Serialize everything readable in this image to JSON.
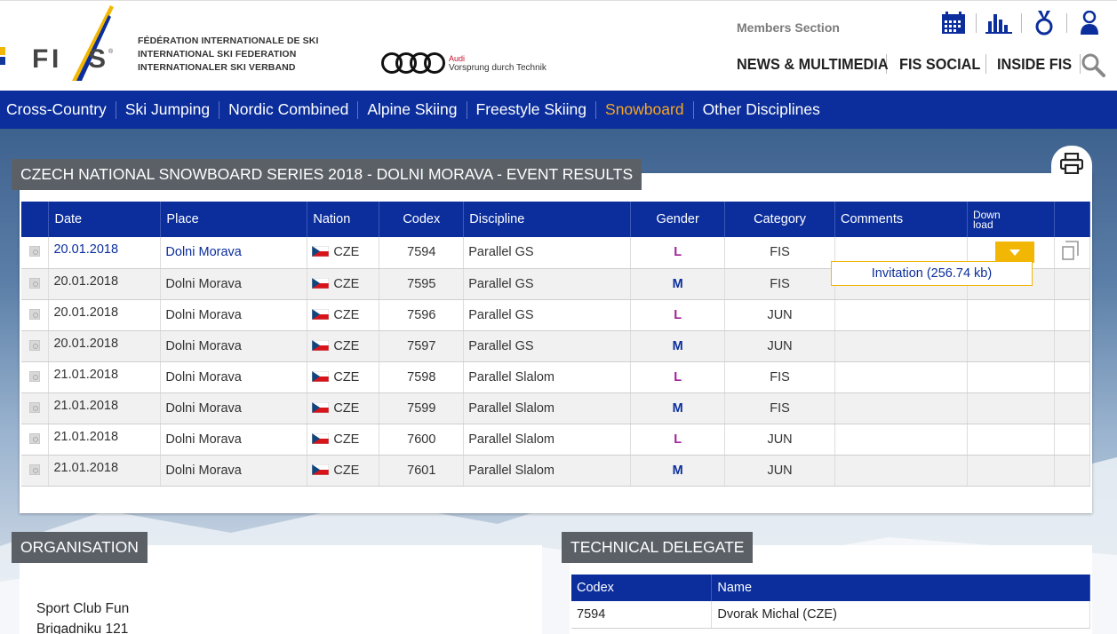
{
  "header": {
    "federation_lines": [
      "FÉDÉRATION INTERNATIONALE DE SKI",
      "INTERNATIONAL SKI FEDERATION",
      "INTERNATIONALER SKI VERBAND"
    ],
    "sponsor": {
      "brand": "Audi",
      "tagline": "Vorsprung durch Technik"
    },
    "members_label": "Members Section",
    "nav": [
      "NEWS & MULTIMEDIA",
      "FIS SOCIAL",
      "INSIDE FIS"
    ]
  },
  "disciplines": [
    "Cross-Country",
    "Ski Jumping",
    "Nordic Combined",
    "Alpine Skiing",
    "Freestyle Skiing",
    "Snowboard",
    "Other Disciplines"
  ],
  "active_discipline": "Snowboard",
  "results": {
    "title": "CZECH NATIONAL SNOWBOARD SERIES 2018 - DOLNI MORAVA - EVENT RESULTS",
    "columns": {
      "date": "Date",
      "place": "Place",
      "nation": "Nation",
      "codex": "Codex",
      "discipline": "Discipline",
      "gender": "Gender",
      "category": "Category",
      "comments": "Comments",
      "download_1": "Down",
      "download_2": "load"
    },
    "rows": [
      {
        "date": "20.01.2018",
        "place": "Dolni Morava",
        "nation": "CZE",
        "codex": "7594",
        "discipline": "Parallel GS",
        "gender": "L",
        "category": "FIS"
      },
      {
        "date": "20.01.2018",
        "place": "Dolni Morava",
        "nation": "CZE",
        "codex": "7595",
        "discipline": "Parallel GS",
        "gender": "M",
        "category": "FIS"
      },
      {
        "date": "20.01.2018",
        "place": "Dolni Morava",
        "nation": "CZE",
        "codex": "7596",
        "discipline": "Parallel GS",
        "gender": "L",
        "category": "JUN"
      },
      {
        "date": "20.01.2018",
        "place": "Dolni Morava",
        "nation": "CZE",
        "codex": "7597",
        "discipline": "Parallel GS",
        "gender": "M",
        "category": "JUN"
      },
      {
        "date": "21.01.2018",
        "place": "Dolni Morava",
        "nation": "CZE",
        "codex": "7598",
        "discipline": "Parallel Slalom",
        "gender": "L",
        "category": "FIS"
      },
      {
        "date": "21.01.2018",
        "place": "Dolni Morava",
        "nation": "CZE",
        "codex": "7599",
        "discipline": "Parallel Slalom",
        "gender": "M",
        "category": "FIS"
      },
      {
        "date": "21.01.2018",
        "place": "Dolni Morava",
        "nation": "CZE",
        "codex": "7600",
        "discipline": "Parallel Slalom",
        "gender": "L",
        "category": "JUN"
      },
      {
        "date": "21.01.2018",
        "place": "Dolni Morava",
        "nation": "CZE",
        "codex": "7601",
        "discipline": "Parallel Slalom",
        "gender": "M",
        "category": "JUN"
      }
    ],
    "download_item": "Invitation (256.74 kb)"
  },
  "organisation": {
    "title": "ORGANISATION",
    "name": "Sport Club Fun",
    "address": "Brigadniku 121"
  },
  "technical_delegate": {
    "title": "TECHNICAL DELEGATE",
    "columns": {
      "codex": "Codex",
      "name": "Name"
    },
    "rows": [
      {
        "codex": "7594",
        "name": "Dvorak Michal (CZE)"
      }
    ]
  },
  "colors": {
    "brand_blue": "#0b2e9c",
    "accent_orange": "#f6a623",
    "download_yellow": "#f2b705",
    "gender_l": "#a3229a",
    "gender_m": "#0b2e9c"
  }
}
